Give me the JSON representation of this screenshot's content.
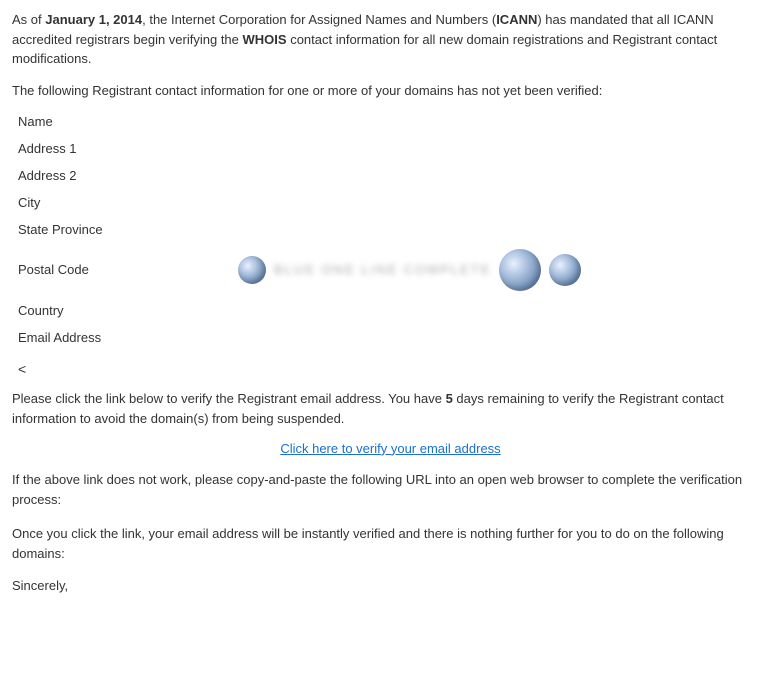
{
  "intro": {
    "part1": "As of January 1, 2014, the Internet Corporation for Assigned Names and Numbers (ICANN) has mandated that all ICANN accredited registrars begin verifying the WHOIS contact information for all new domain registrations and Registrant contact modifications.",
    "date_bold": "January 1, 2014",
    "org_bold": "ICANN",
    "whois_bold": "WHOIS"
  },
  "not_verified": "The following Registrant contact information for one or more of your domains has not yet been verified:",
  "contact_fields": [
    {
      "label": "Name",
      "value": ""
    },
    {
      "label": "Address 1",
      "value": ""
    },
    {
      "label": "Address 2",
      "value": ""
    },
    {
      "label": "City",
      "value": ""
    },
    {
      "label": "State Province",
      "value": ""
    },
    {
      "label": "Postal Code",
      "value": ""
    },
    {
      "label": "Country",
      "value": ""
    },
    {
      "label": "Email Address",
      "value": ""
    }
  ],
  "back_arrow": "<",
  "verify_paragraph": {
    "text_before": "Please click the link below to verify the Registrant email address. You have ",
    "days_bold": "5",
    "text_after": " days remaining to verify the Registrant contact information to avoid the domain(s) from being suspended."
  },
  "verify_link_text": "Click here to verify your email address",
  "url_paragraph": "If the above link does not work, please copy-and-paste the following URL into an open web browser to complete the verification process:",
  "url_value": "",
  "once_paragraph": "Once you click the link, your email address will be instantly verified and there is nothing further for you to do on the following domains:",
  "domains_value": "",
  "sincerely": "Sincerely,"
}
